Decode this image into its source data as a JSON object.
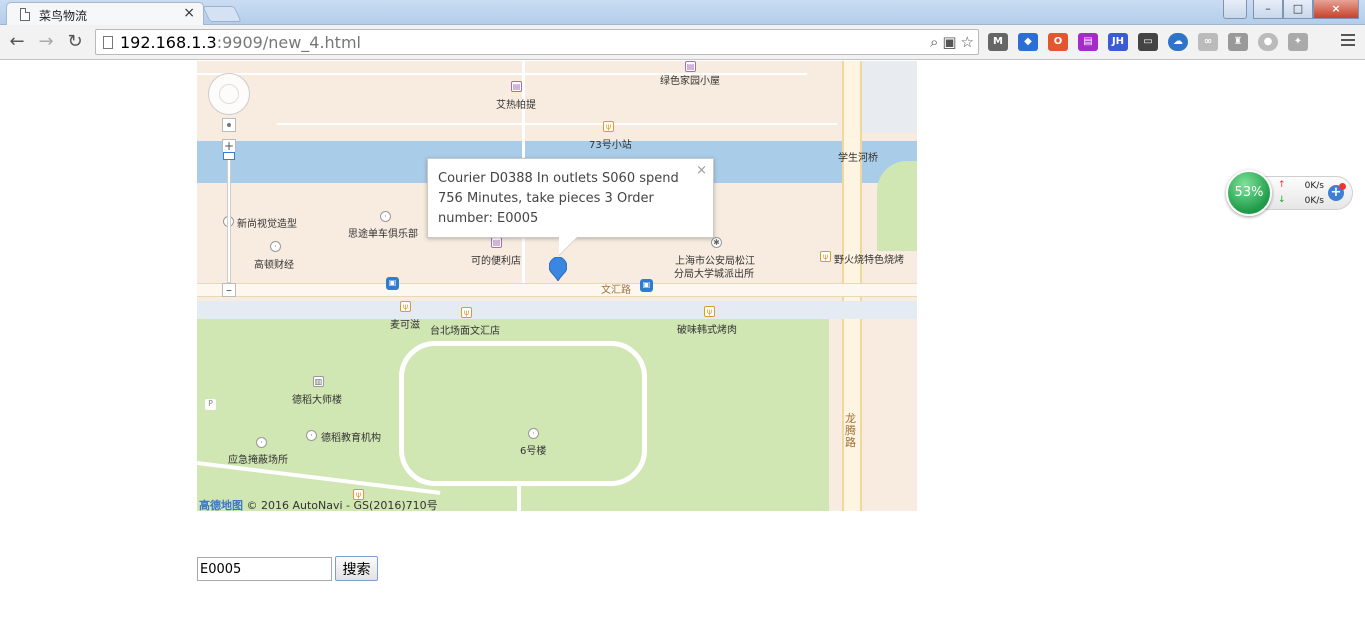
{
  "browser": {
    "tab_title": "菜鸟物流",
    "tab_close": "×",
    "url_host": "192.168.1.3",
    "url_rest": ":9909/new_4.html",
    "win_min": "–",
    "win_max": "□",
    "win_close": "×"
  },
  "map": {
    "infowindow_text": "Courier D0388 In outlets S060 spend 756 Minutes, take pieces 3 Order number: E0005",
    "infowindow_close": "×",
    "labels": {
      "l1": "绿色家园小屋",
      "l2": "艾热帕提",
      "l3": "73号小站",
      "l4": "学生河桥",
      "l5": "新尚视觉造型",
      "l6": "思途单车俱乐部",
      "l7": "高顿财经",
      "l8": "可的便利店",
      "l9": "上海市公安局松江",
      "l10": "分局大学城派出所",
      "l11": "野火烧特色烧烤",
      "l12": "文汇路",
      "l13": "麦可滋",
      "l14": "台北场面文汇店",
      "l15": "破味韩式烤肉",
      "l16": "德稻大师楼",
      "l17": "德稻教育机构",
      "l18": "应急掩蔽场所",
      "l19": "6号楼",
      "l20": "龙\n腾\n路"
    },
    "copyright_brand": "高德地图",
    "copyright_text": "© 2016 AutoNavi - GS(2016)710号"
  },
  "search": {
    "value": "E0005",
    "button_label": "搜索"
  },
  "net_widget": {
    "percent": "53%",
    "up_speed": "0K/s",
    "down_speed": "0K/s"
  },
  "colors": {
    "water": "#a9cce8",
    "park": "#d0e6b3",
    "marker": "#3a86e0"
  }
}
